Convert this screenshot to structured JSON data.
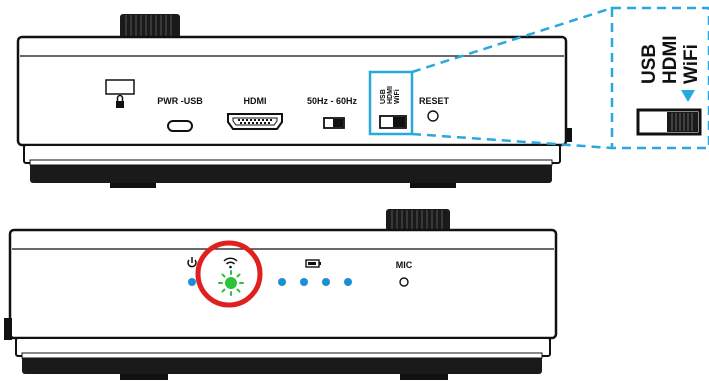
{
  "top_device": {
    "ports": {
      "power_usb": "PWR -USB",
      "hdmi": "HDMI",
      "freq_switch": "50Hz - 60Hz",
      "mode_switch_lines": [
        "USB",
        "HDMI",
        "WiFi"
      ],
      "reset": "RESET"
    }
  },
  "callout": {
    "lines": [
      "USB",
      "HDMI",
      "WiFi"
    ],
    "selected": "WiFi"
  },
  "bottom_device": {
    "mic_label": "MIC",
    "highlighted_indicator": "wifi-led"
  },
  "colors": {
    "callout_line": "#29a8e0",
    "led_blue": "#1a8fd6",
    "led_green": "#2ec23a",
    "highlight_circle": "#e02020"
  },
  "icons": [
    "lock-icon",
    "power-icon",
    "wifi-icon",
    "battery-icon"
  ]
}
